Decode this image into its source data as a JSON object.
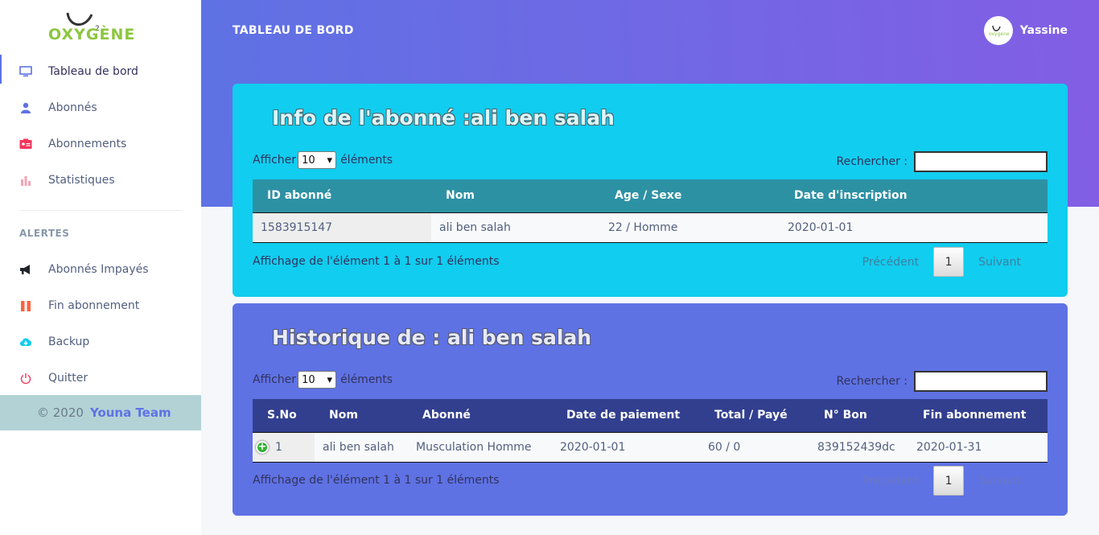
{
  "logo": {
    "text": "OXYGÈNE",
    "superscript": "2"
  },
  "sidebar": {
    "items": [
      {
        "label": "Tableau de bord",
        "icon": "monitor-icon",
        "color": "#5e72e4",
        "active": true
      },
      {
        "label": "Abonnés",
        "icon": "user-icon",
        "color": "#5e72e4"
      },
      {
        "label": "Abonnements",
        "icon": "id-card-icon",
        "color": "#f5365c"
      },
      {
        "label": "Statistiques",
        "icon": "bar-chart-icon",
        "color": "#f3a4b5"
      }
    ],
    "alerts_heading": "ALERTES",
    "alerts": [
      {
        "label": "Abonnés Impayés",
        "icon": "megaphone-icon",
        "color": "#212529"
      },
      {
        "label": "Fin abonnement",
        "icon": "pause-icon",
        "color": "#fb6340"
      },
      {
        "label": "Backup",
        "icon": "cloud-download-icon",
        "color": "#11cdef"
      },
      {
        "label": "Quitter",
        "icon": "power-icon",
        "color": "#f5365c"
      }
    ],
    "footer": {
      "copyright": "© 2020",
      "team": "Youna Team"
    }
  },
  "header": {
    "title": "TABLEAU DE BORD",
    "user": "Yassine"
  },
  "card1": {
    "title": "Info de l'abonné :ali ben salah",
    "show_prefix": "Afficher",
    "show_value": "10",
    "show_suffix": "éléments",
    "search_label": "Rechercher :",
    "columns": [
      "ID abonné",
      "Nom",
      "Age / Sexe",
      "Date d'inscription"
    ],
    "rows": [
      [
        "1583915147",
        "ali ben salah",
        "22 / Homme",
        "2020-01-01"
      ]
    ],
    "info": "Affichage de l'élément 1 à 1 sur 1 éléments",
    "prev": "Précédent",
    "page": "1",
    "next": "Suivant"
  },
  "card2": {
    "title": "Historique de : ali ben salah",
    "show_prefix": "Afficher",
    "show_value": "10",
    "show_suffix": "éléments",
    "search_label": "Rechercher :",
    "columns": [
      "S.No",
      "Nom",
      "Abonné",
      "Date de paiement",
      "Total / Payé",
      "N° Bon",
      "Fin abonnement"
    ],
    "rows": [
      [
        "1",
        "ali ben salah",
        "Musculation Homme",
        "2020-01-01",
        "60 / 0",
        "839152439dc",
        "2020-01-31"
      ]
    ],
    "info": "Affichage de l'élément 1 à 1 sur 1 éléments",
    "prev": "Précédent",
    "page": "1",
    "next": "Suivant"
  },
  "colors": {
    "primary": "#5e72e4",
    "info": "#11cdef",
    "logo_green": "#8dc63f"
  }
}
